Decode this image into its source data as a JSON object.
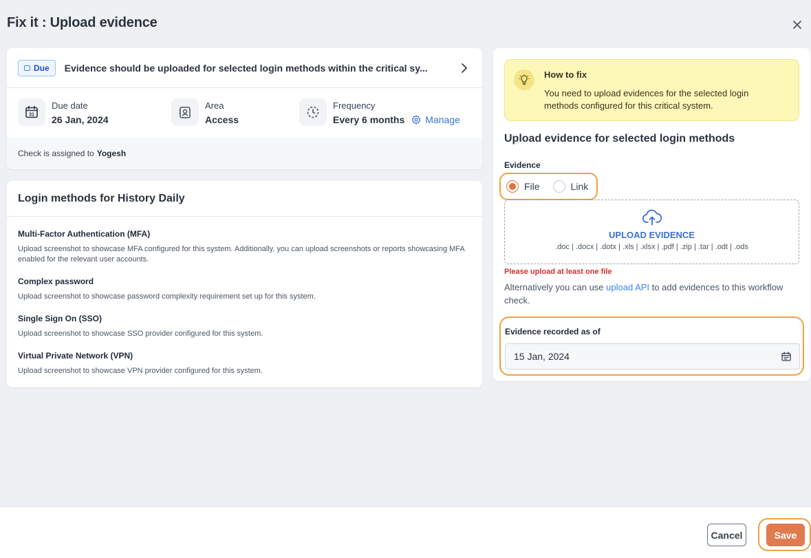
{
  "dialog": {
    "title": "Fix it : Upload evidence"
  },
  "check": {
    "badge": "Due",
    "summary": "Evidence should be uploaded for selected login methods within the critical sy...",
    "due_date_label": "Due date",
    "due_date_value": "26 Jan, 2024",
    "area_label": "Area",
    "area_value": "Access",
    "frequency_label": "Frequency",
    "frequency_value": "Every 6 months",
    "manage_label": "Manage",
    "assigned_prefix": "Check is assigned to",
    "assigned_to": "Yogesh"
  },
  "login_methods": {
    "title": "Login methods for History Daily",
    "items": [
      {
        "name": "Multi-Factor Authentication (MFA)",
        "description": "Upload screenshot to showcase MFA configured for this system. Additionally, you can upload screenshots or reports showcasing MFA enabled for the relevant user accounts."
      },
      {
        "name": "Complex password",
        "description": "Upload screenshot to showcase password complexity requirement set up for this system."
      },
      {
        "name": "Single Sign On (SSO)",
        "description": "Upload screenshot to showcase SSO provider configured for this system."
      },
      {
        "name": "Virtual Private Network (VPN)",
        "description": "Upload screenshot to showcase VPN provider configured for this system."
      }
    ]
  },
  "how_to_fix": {
    "title": "How to fix",
    "description": "You need to upload evidences for the selected login methods configured for this critical system."
  },
  "upload": {
    "title": "Upload evidence for selected login methods",
    "evidence_label": "Evidence",
    "option_file": "File",
    "option_link": "Link",
    "selected_option": "File",
    "dropzone_title": "UPLOAD EVIDENCE",
    "dropzone_formats": ".doc | .docx | .dotx | .xls | .xlsx | .pdf | .zip | .tar | .odt | .ods",
    "error": "Please upload at least one file",
    "alt_prefix": "Alternatively you can use",
    "alt_link": "upload API",
    "alt_suffix": "to add evidences to this workflow check.",
    "recorded_label": "Evidence recorded as of",
    "recorded_value": "15 Jan, 2024"
  },
  "footer": {
    "cancel_label": "Cancel",
    "save_label": "Save"
  },
  "colors": {
    "accent": "#e07b4f",
    "link": "#3b6fd4",
    "highlight": "#f0a040",
    "error": "#d32f2f",
    "hint_bg": "#fdf8b8"
  }
}
